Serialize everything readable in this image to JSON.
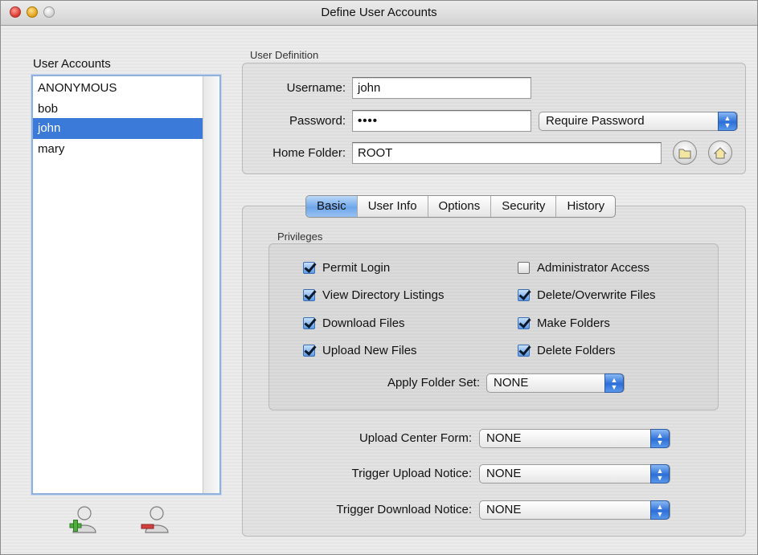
{
  "window": {
    "title": "Define User Accounts"
  },
  "accounts": {
    "heading": "User Accounts",
    "items": [
      "ANONYMOUS",
      "bob",
      "john",
      "mary"
    ],
    "selected": "john",
    "add_icon": "add-user-icon",
    "remove_icon": "remove-user-icon"
  },
  "definition": {
    "group_title": "User Definition",
    "username_label": "Username:",
    "username_value": "john",
    "password_label": "Password:",
    "password_value": "••••",
    "password_mode": "Require Password",
    "home_label": "Home Folder:",
    "home_value": "ROOT",
    "browse_icon": "folder-icon",
    "home_icon": "home-icon"
  },
  "tabs": [
    "Basic",
    "User Info",
    "Options",
    "Security",
    "History"
  ],
  "active_tab": "Basic",
  "privileges": {
    "group_title": "Privileges",
    "items": [
      {
        "label": "Permit Login",
        "checked": true
      },
      {
        "label": "Administrator Access",
        "checked": false
      },
      {
        "label": "View Directory Listings",
        "checked": true
      },
      {
        "label": "Delete/Overwrite Files",
        "checked": true
      },
      {
        "label": "Download Files",
        "checked": true
      },
      {
        "label": "Make Folders",
        "checked": true
      },
      {
        "label": "Upload New Files",
        "checked": true
      },
      {
        "label": "Delete Folders",
        "checked": true
      }
    ],
    "folder_set_label": "Apply Folder Set:",
    "folder_set_value": "NONE"
  },
  "forms": {
    "upload_center_label": "Upload Center Form:",
    "upload_center_value": "NONE",
    "trigger_upload_label": "Trigger Upload Notice:",
    "trigger_upload_value": "NONE",
    "trigger_download_label": "Trigger Download Notice:",
    "trigger_download_value": "NONE"
  },
  "colors": {
    "selection": "#3b7ad9",
    "popup_arrow": "#2c6fd8",
    "active_tab": "#6ea6ea"
  }
}
